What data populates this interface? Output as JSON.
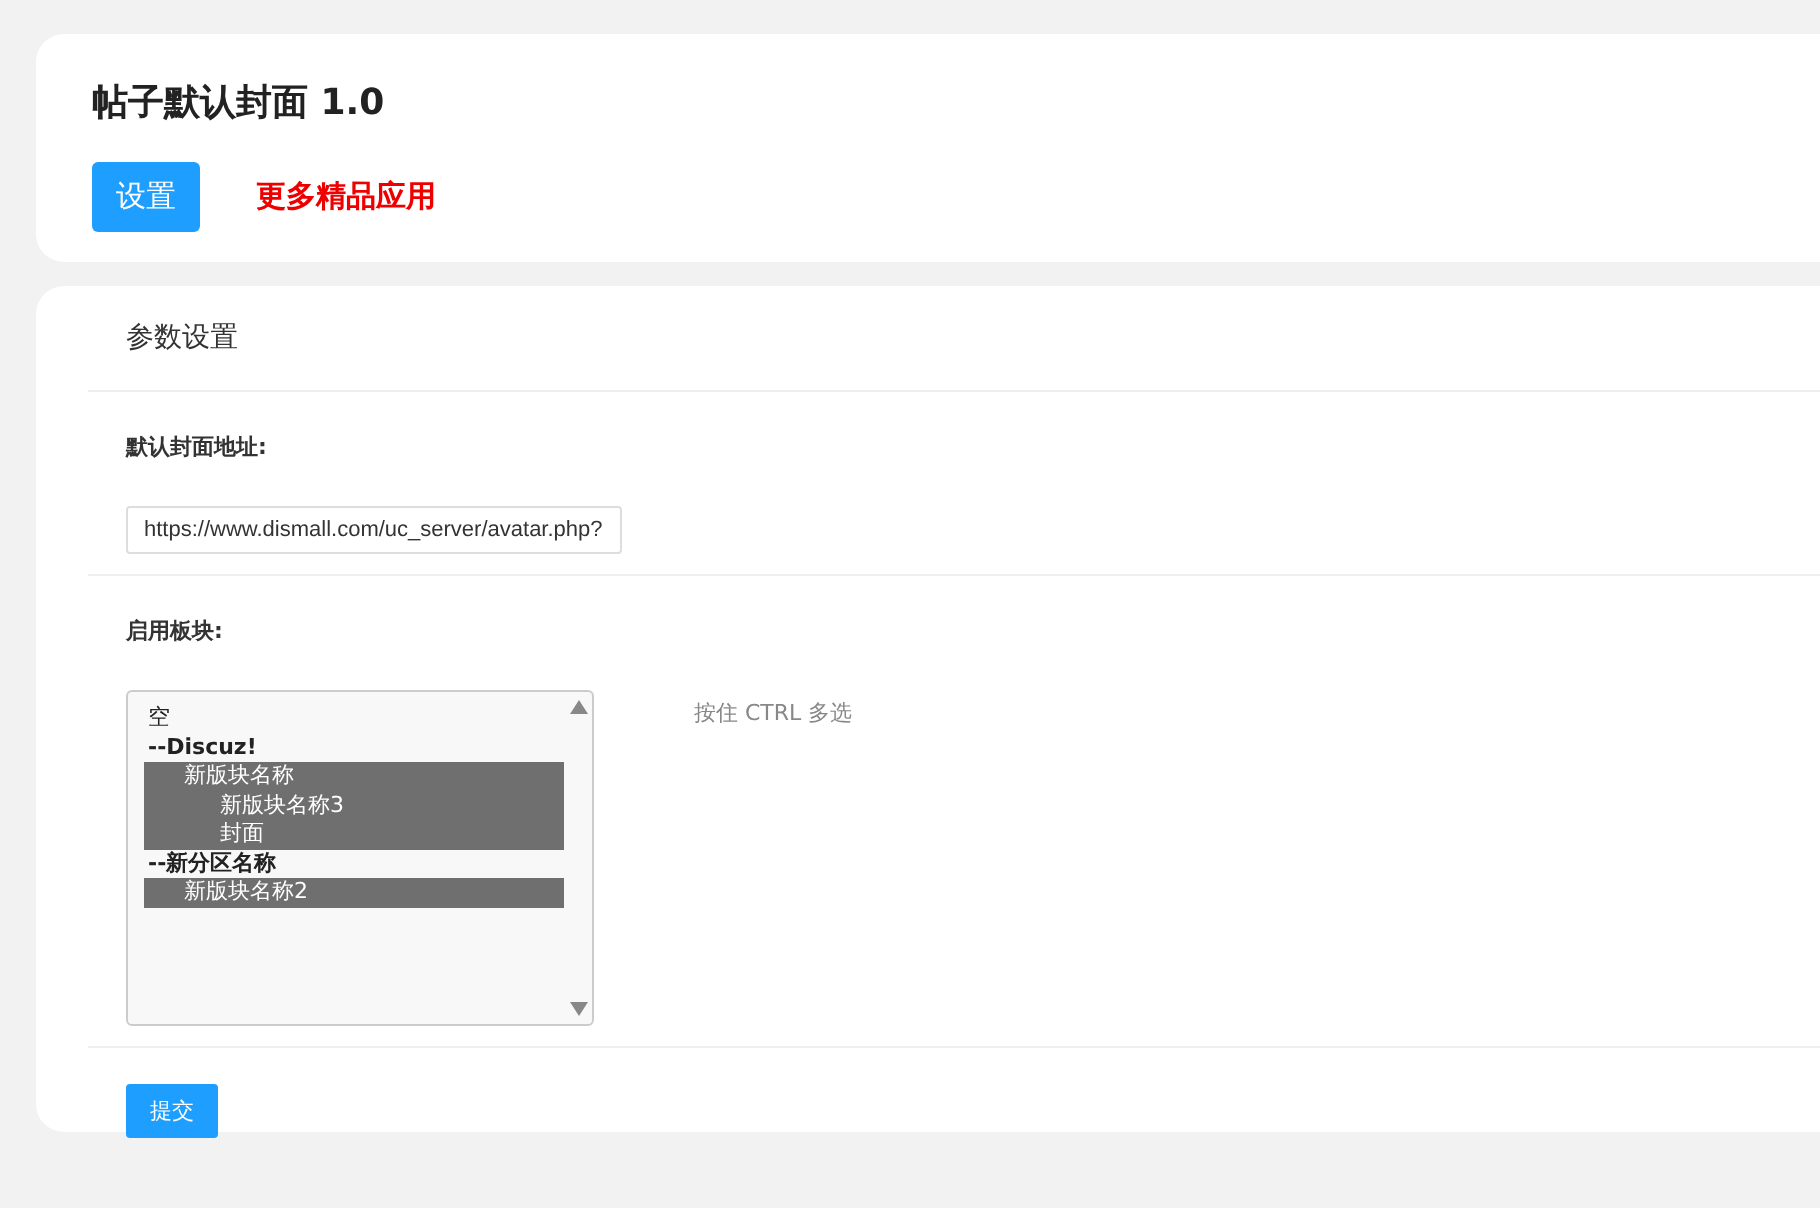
{
  "header": {
    "title": "帖子默认封面 1.0",
    "tabs": [
      {
        "label": "设置",
        "selected": true
      },
      {
        "label": "更多精品应用",
        "selected": false
      }
    ]
  },
  "panel": {
    "title": "参数设置",
    "fields": [
      {
        "kind": "text",
        "label": "默认封面地址:",
        "value": "https://www.dismall.com/uc_server/avatar.php?"
      },
      {
        "kind": "multiselect",
        "label": "启用板块:",
        "hint": "按住 CTRL 多选",
        "options": [
          {
            "label": "空",
            "kind": "option",
            "selected": false
          },
          {
            "label": "--Discuz!",
            "kind": "group",
            "children": [
              {
                "label": "新版块名称",
                "kind": "option",
                "selected": true,
                "children": [
                  {
                    "label": "新版块名称3",
                    "kind": "option",
                    "selected": true
                  },
                  {
                    "label": "封面",
                    "kind": "option",
                    "selected": true
                  }
                ]
              }
            ]
          },
          {
            "label": "--新分区名称",
            "kind": "group",
            "children": [
              {
                "label": "新版块名称2",
                "kind": "option",
                "selected": true
              }
            ]
          }
        ]
      }
    ],
    "submit": "提交"
  }
}
